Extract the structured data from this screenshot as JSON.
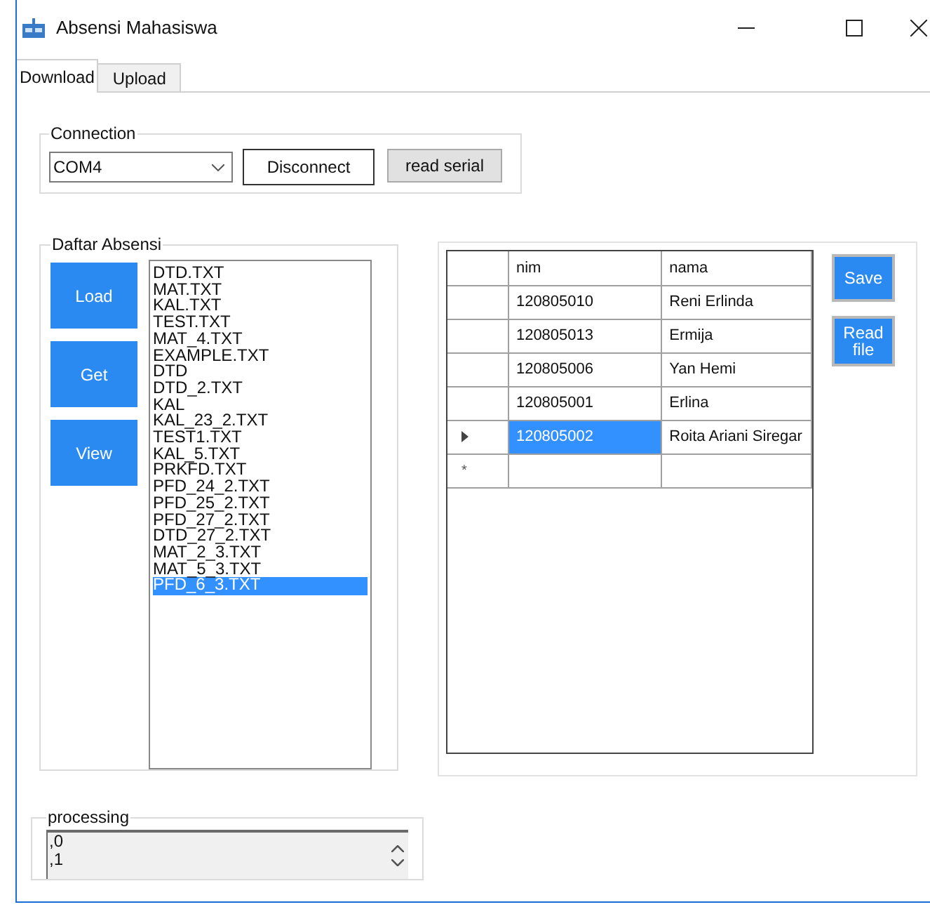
{
  "window": {
    "title": "Absensi Mahasiswa"
  },
  "tabs": [
    {
      "label": "Download",
      "selected": true
    },
    {
      "label": "Upload",
      "selected": false
    }
  ],
  "connection": {
    "title": "Connection",
    "port": "COM4",
    "buttons": [
      {
        "label": "Disconnect",
        "kind": "outlined"
      },
      {
        "label": "read serial",
        "kind": "flat"
      }
    ]
  },
  "daftar_absensi": {
    "title": "Daftar Absensi",
    "buttons": [
      "Load",
      "Get",
      "View"
    ],
    "files": [
      {
        "label": "DTD.TXT",
        "selected": false
      },
      {
        "label": "MAT.TXT",
        "selected": false
      },
      {
        "label": "KAL.TXT",
        "selected": false
      },
      {
        "label": "TEST.TXT",
        "selected": false
      },
      {
        "label": "MAT_4.TXT",
        "selected": false
      },
      {
        "label": "EXAMPLE.TXT",
        "selected": false
      },
      {
        "label": "DTD",
        "selected": false
      },
      {
        "label": "DTD_2.TXT",
        "selected": false
      },
      {
        "label": "KAL",
        "selected": false
      },
      {
        "label": "KAL_23_2.TXT",
        "selected": false
      },
      {
        "label": "TEST1.TXT",
        "selected": false
      },
      {
        "label": "KAL_5.TXT",
        "selected": false
      },
      {
        "label": "PRKFD.TXT",
        "selected": false
      },
      {
        "label": "PFD_24_2.TXT",
        "selected": false
      },
      {
        "label": "PFD_25_2.TXT",
        "selected": false
      },
      {
        "label": "PFD_27_2.TXT",
        "selected": false
      },
      {
        "label": "DTD_27_2.TXT",
        "selected": false
      },
      {
        "label": "MAT_2_3.TXT",
        "selected": false
      },
      {
        "label": "MAT_5_3.TXT",
        "selected": false
      },
      {
        "label": "PFD_6_3.TXT",
        "selected": true
      }
    ]
  },
  "table": {
    "columns": [
      "nim",
      "nama"
    ],
    "rows": [
      {
        "kind": "data",
        "selected": false,
        "cells": [
          "120805010",
          "Reni Erlinda"
        ]
      },
      {
        "kind": "data",
        "selected": false,
        "cells": [
          "120805013",
          "Ermija"
        ]
      },
      {
        "kind": "data",
        "selected": false,
        "cells": [
          "120805006",
          "Yan Hemi"
        ]
      },
      {
        "kind": "data",
        "selected": false,
        "cells": [
          "120805001",
          "Erlina"
        ]
      },
      {
        "kind": "data",
        "selected": true,
        "cells": [
          "120805002",
          "Roita Ariani Siregar"
        ]
      },
      {
        "kind": "new",
        "marker": "*"
      }
    ]
  },
  "side_buttons": [
    "Save",
    "Read file"
  ],
  "processing": {
    "title": "processing",
    "lines": [
      ",0",
      ",1"
    ]
  }
}
